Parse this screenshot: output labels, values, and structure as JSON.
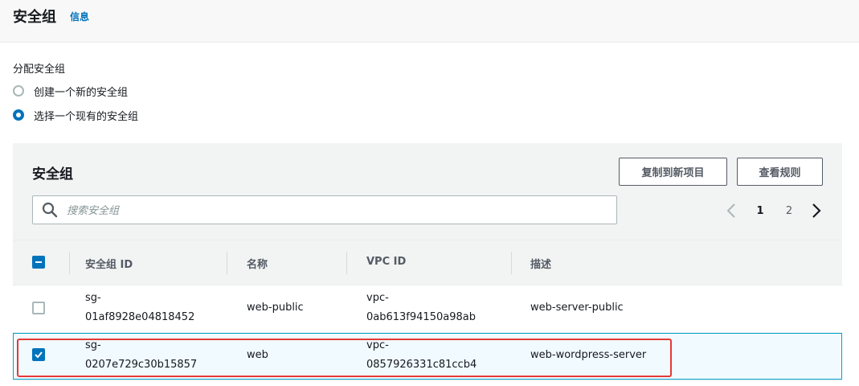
{
  "header": {
    "title": "安全组",
    "info_link": "信息"
  },
  "assign": {
    "label": "分配安全组",
    "options": [
      {
        "label": "创建一个新的安全组",
        "selected": false
      },
      {
        "label": "选择一个现有的安全组",
        "selected": true
      }
    ]
  },
  "panel": {
    "title": "安全组",
    "buttons": {
      "copy": "复制到新项目",
      "view_rules": "查看规则"
    },
    "search": {
      "placeholder": "搜索安全组",
      "value": ""
    },
    "pagination": {
      "current": "1",
      "next_page": "2"
    }
  },
  "table": {
    "headers": {
      "id": "安全组 ID",
      "name": "名称",
      "vpc": "VPC ID",
      "desc": "描述"
    },
    "rows": [
      {
        "checked": false,
        "id_line1": "sg-",
        "id_line2": "01af8928e04818452",
        "name": "web-public",
        "vpc_line1": "vpc-",
        "vpc_line2": "0ab613f94150a98ab",
        "desc": "web-server-public"
      },
      {
        "checked": true,
        "id_line1": "sg-",
        "id_line2": "0207e729c30b15857",
        "name": "web",
        "vpc_line1": "vpc-",
        "vpc_line2": "0857926331c81ccb4",
        "desc": "web-wordpress-server"
      }
    ]
  },
  "colors": {
    "accent": "#0073bb",
    "selected_row_bg": "#f1faff",
    "selected_row_border": "#00a1c9",
    "highlight": "#e53935"
  },
  "icons": [
    "search-icon",
    "chevron-left-icon",
    "chevron-right-icon",
    "checkbox-indeterminate-icon",
    "checkmark-icon"
  ]
}
